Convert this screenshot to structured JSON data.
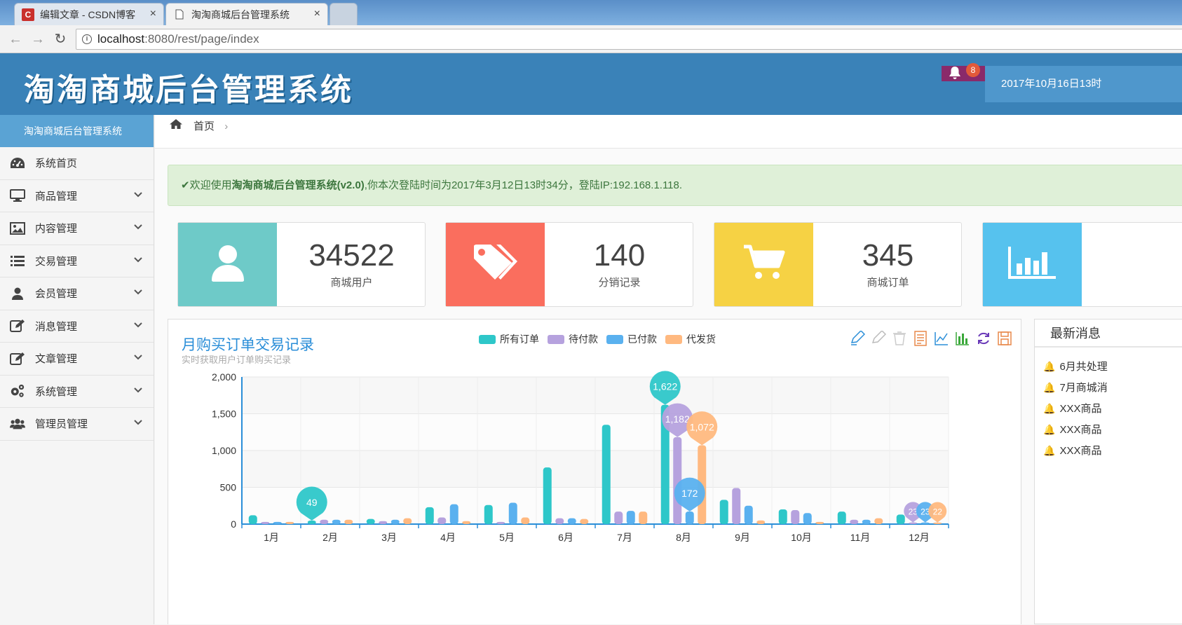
{
  "browser": {
    "tabs": [
      {
        "favicon": "C",
        "title": "编辑文章 - CSDN博客",
        "close": "×"
      },
      {
        "favicon": "page-icon",
        "title": "淘淘商城后台管理系统",
        "close": "×"
      }
    ],
    "url_host": "localhost",
    "url_rest": ":8080/rest/page/index"
  },
  "header": {
    "logo": "淘淘商城后台管理系统",
    "bell_count": "8",
    "datetime": "2017年10月16日13时"
  },
  "sidebar": {
    "title": "淘淘商城后台管理系统",
    "items": [
      {
        "label": "系统首页",
        "icon": "dashboard-icon"
      },
      {
        "label": "商品管理",
        "icon": "monitor-icon"
      },
      {
        "label": "内容管理",
        "icon": "image-icon"
      },
      {
        "label": "交易管理",
        "icon": "list-icon"
      },
      {
        "label": "会员管理",
        "icon": "user-icon"
      },
      {
        "label": "消息管理",
        "icon": "edit-icon"
      },
      {
        "label": "文章管理",
        "icon": "edit-icon"
      },
      {
        "label": "系统管理",
        "icon": "gears-icon"
      },
      {
        "label": "管理员管理",
        "icon": "users-icon"
      }
    ]
  },
  "breadcrumb": {
    "home": "首页"
  },
  "alert": {
    "prefix": "欢迎使用",
    "system": "淘淘商城后台管理系统(v2.0)",
    "suffix": ",你本次登陆时间为2017年3月12日13时34分，登陆IP:192.168.1.118."
  },
  "stats": [
    {
      "value": "34522",
      "label": "商城用户",
      "color": "#6ecac8",
      "icon": "user-icon"
    },
    {
      "value": "140",
      "label": "分销记录",
      "color": "#fa6e5e",
      "icon": "tags-icon"
    },
    {
      "value": "345",
      "label": "商城订单",
      "color": "#f6d244",
      "icon": "cart-icon"
    },
    {
      "value": "",
      "label": "",
      "color": "#56c2ee",
      "icon": "bar-chart-icon"
    }
  ],
  "chart_panel": {
    "title": "月购买订单交易记录",
    "subtitle": "实时获取用户订单购买记录"
  },
  "messages": {
    "title": "最新消息",
    "items": [
      "6月共处理",
      "7月商城消",
      "XXX商品",
      "XXX商品",
      "XXX商品"
    ]
  },
  "chart_data": {
    "type": "bar",
    "categories": [
      "1月",
      "2月",
      "3月",
      "4月",
      "5月",
      "6月",
      "7月",
      "8月",
      "9月",
      "10月",
      "11月",
      "12月"
    ],
    "ylim": [
      0,
      2000
    ],
    "yticks": [
      "0",
      "500",
      "1,000",
      "1,500",
      "2,000"
    ],
    "series": [
      {
        "name": "所有订单",
        "color": "#2ec7c9",
        "values": [
          120,
          49,
          70,
          230,
          260,
          770,
          1350,
          1622,
          330,
          200,
          170,
          130
        ]
      },
      {
        "name": "待付款",
        "color": "#b6a2de",
        "values": [
          30,
          60,
          40,
          90,
          30,
          80,
          170,
          1182,
          490,
          190,
          60,
          23
        ]
      },
      {
        "name": "已付款",
        "color": "#5ab1ef",
        "values": [
          30,
          60,
          60,
          270,
          290,
          80,
          180,
          172,
          250,
          150,
          60,
          23
        ]
      },
      {
        "name": "代发货",
        "color": "#ffb980",
        "values": [
          30,
          60,
          80,
          40,
          90,
          70,
          170,
          1072,
          50,
          30,
          80,
          22
        ]
      }
    ],
    "markers": [
      {
        "series": 0,
        "index": 1,
        "label": "49"
      },
      {
        "series": 0,
        "index": 7,
        "label": "1,622"
      },
      {
        "series": 1,
        "index": 7,
        "label": "1,182"
      },
      {
        "series": 3,
        "index": 7,
        "label": "1,072"
      },
      {
        "series": 2,
        "index": 7,
        "label": "172"
      },
      {
        "series": 1,
        "index": 11,
        "label": "23"
      },
      {
        "series": 2,
        "index": 11,
        "label": "23"
      },
      {
        "series": 3,
        "index": 11,
        "label": "22"
      }
    ]
  }
}
